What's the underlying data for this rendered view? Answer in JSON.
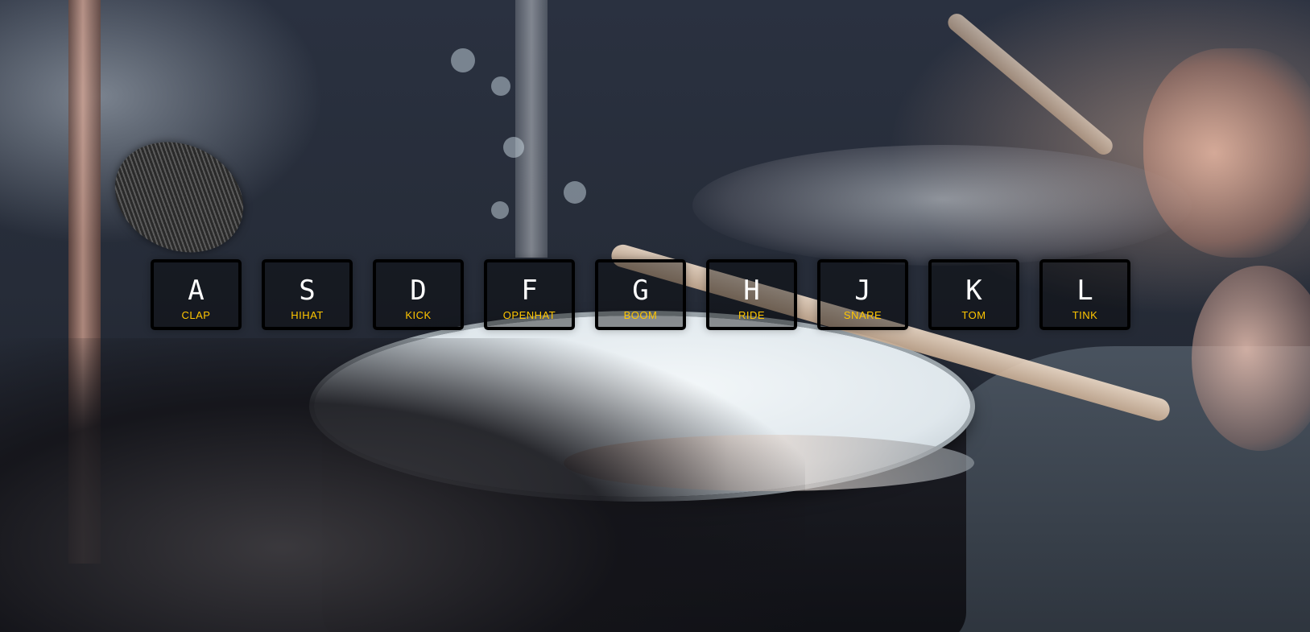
{
  "colors": {
    "sound_label": "#ffc600",
    "key_border": "#000000",
    "key_letter": "#ffffff"
  },
  "keys": [
    {
      "letter": "A",
      "sound": "CLAP"
    },
    {
      "letter": "S",
      "sound": "HIHAT"
    },
    {
      "letter": "D",
      "sound": "KICK"
    },
    {
      "letter": "F",
      "sound": "OPENHAT"
    },
    {
      "letter": "G",
      "sound": "BOOM"
    },
    {
      "letter": "H",
      "sound": "RIDE"
    },
    {
      "letter": "J",
      "sound": "SNARE"
    },
    {
      "letter": "K",
      "sound": "TOM"
    },
    {
      "letter": "L",
      "sound": "TINK"
    }
  ]
}
